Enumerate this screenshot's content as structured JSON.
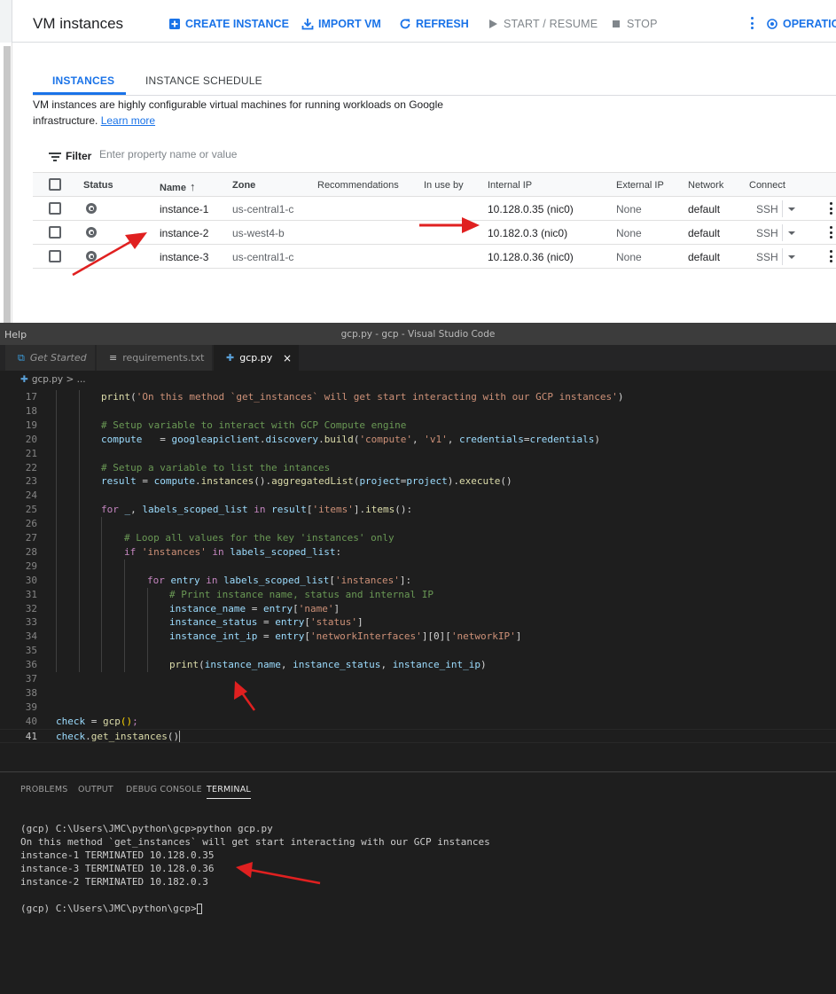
{
  "gcp": {
    "title": "VM instances",
    "toolbar": {
      "create": "CREATE INSTANCE",
      "import": "IMPORT VM",
      "refresh": "REFRESH",
      "start": "START / RESUME",
      "stop": "STOP",
      "operations": "OPERATION"
    },
    "tabs": [
      "INSTANCES",
      "INSTANCE SCHEDULE"
    ],
    "description": "VM instances are highly configurable virtual machines for running workloads on Google infrastructure.",
    "learn_more": "Learn more",
    "filter": {
      "label": "Filter",
      "placeholder": "Enter property name or value"
    },
    "columns": [
      "Status",
      "Name",
      "Zone",
      "Recommendations",
      "In use by",
      "Internal IP",
      "External IP",
      "Network",
      "Connect"
    ],
    "sort_indicator": "↑",
    "rows": [
      {
        "name": "instance-1",
        "zone": "us-central1-c",
        "ip": "10.128.0.35",
        "nic": "(nic0)",
        "external": "None",
        "network": "default",
        "connect": "SSH"
      },
      {
        "name": "instance-2",
        "zone": "us-west4-b",
        "ip": "10.182.0.3",
        "nic": "(nic0)",
        "external": "None",
        "network": "default",
        "connect": "SSH"
      },
      {
        "name": "instance-3",
        "zone": "us-central1-c",
        "ip": "10.128.0.36",
        "nic": "(nic0)",
        "external": "None",
        "network": "default",
        "connect": "SSH"
      }
    ]
  },
  "vscode": {
    "menu_help": "Help",
    "window_title": "gcp.py - gcp - Visual Studio Code",
    "tabs": [
      "Get Started",
      "requirements.txt",
      "gcp.py"
    ],
    "close_glyph": "×",
    "breadcrumb": "gcp.py > ...",
    "code": [
      {
        "n": "17",
        "i": 2,
        "t": [
          [
            "fn",
            "print"
          ],
          [
            "op",
            "("
          ],
          [
            "str",
            "'On this method `get_instances` will get start interacting with our GCP instances'"
          ],
          [
            "op",
            ")"
          ]
        ]
      },
      {
        "n": "18",
        "i": 2,
        "t": []
      },
      {
        "n": "19",
        "i": 2,
        "t": [
          [
            "cm",
            "# Setup variable to interact with GCP Compute engine"
          ]
        ]
      },
      {
        "n": "20",
        "i": 2,
        "t": [
          [
            "var",
            "compute"
          ],
          [
            "op",
            "   = "
          ],
          [
            "var",
            "googleapiclient"
          ],
          [
            "op",
            "."
          ],
          [
            "var",
            "discovery"
          ],
          [
            "op",
            "."
          ],
          [
            "fn",
            "build"
          ],
          [
            "op",
            "("
          ],
          [
            "str",
            "'compute'"
          ],
          [
            "op",
            ", "
          ],
          [
            "str",
            "'v1'"
          ],
          [
            "op",
            ", "
          ],
          [
            "var",
            "credentials"
          ],
          [
            "op",
            "="
          ],
          [
            "var",
            "credentials"
          ],
          [
            "op",
            ")"
          ]
        ]
      },
      {
        "n": "21",
        "i": 2,
        "t": []
      },
      {
        "n": "22",
        "i": 2,
        "t": [
          [
            "cm",
            "# Setup a variable to list the intances"
          ]
        ]
      },
      {
        "n": "23",
        "i": 2,
        "t": [
          [
            "var",
            "result"
          ],
          [
            "op",
            " = "
          ],
          [
            "var",
            "compute"
          ],
          [
            "op",
            "."
          ],
          [
            "fn",
            "instances"
          ],
          [
            "op",
            "()."
          ],
          [
            "fn",
            "aggregatedList"
          ],
          [
            "op",
            "("
          ],
          [
            "var",
            "project"
          ],
          [
            "op",
            "="
          ],
          [
            "var",
            "project"
          ],
          [
            "op",
            ")."
          ],
          [
            "fn",
            "execute"
          ],
          [
            "op",
            "()"
          ]
        ]
      },
      {
        "n": "24",
        "i": 2,
        "t": []
      },
      {
        "n": "25",
        "i": 2,
        "t": [
          [
            "kw",
            "for"
          ],
          [
            "op",
            " "
          ],
          [
            "var",
            "_"
          ],
          [
            "op",
            ", "
          ],
          [
            "var",
            "labels_scoped_list"
          ],
          [
            "op",
            " "
          ],
          [
            "kw",
            "in"
          ],
          [
            "op",
            " "
          ],
          [
            "var",
            "result"
          ],
          [
            "op",
            "["
          ],
          [
            "str",
            "'items'"
          ],
          [
            "op",
            "]."
          ],
          [
            "fn",
            "items"
          ],
          [
            "op",
            "():"
          ]
        ]
      },
      {
        "n": "26",
        "i": 3,
        "t": []
      },
      {
        "n": "27",
        "i": 3,
        "t": [
          [
            "cm",
            "# Loop all values for the key 'instances' only"
          ]
        ]
      },
      {
        "n": "28",
        "i": 3,
        "t": [
          [
            "kw",
            "if"
          ],
          [
            "op",
            " "
          ],
          [
            "str",
            "'instances'"
          ],
          [
            "op",
            " "
          ],
          [
            "kw",
            "in"
          ],
          [
            "op",
            " "
          ],
          [
            "var",
            "labels_scoped_list"
          ],
          [
            "op",
            ":"
          ]
        ]
      },
      {
        "n": "29",
        "i": 4,
        "t": []
      },
      {
        "n": "30",
        "i": 4,
        "t": [
          [
            "kw",
            "for"
          ],
          [
            "op",
            " "
          ],
          [
            "var",
            "entry"
          ],
          [
            "op",
            " "
          ],
          [
            "kw",
            "in"
          ],
          [
            "op",
            " "
          ],
          [
            "var",
            "labels_scoped_list"
          ],
          [
            "op",
            "["
          ],
          [
            "str",
            "'instances'"
          ],
          [
            "op",
            "]:"
          ]
        ]
      },
      {
        "n": "31",
        "i": 5,
        "t": [
          [
            "cm",
            "# Print instance name, status and internal IP"
          ]
        ]
      },
      {
        "n": "32",
        "i": 5,
        "t": [
          [
            "var",
            "instance_name"
          ],
          [
            "op",
            " = "
          ],
          [
            "var",
            "entry"
          ],
          [
            "op",
            "["
          ],
          [
            "str",
            "'name'"
          ],
          [
            "op",
            "]"
          ]
        ]
      },
      {
        "n": "33",
        "i": 5,
        "t": [
          [
            "var",
            "instance_status"
          ],
          [
            "op",
            " = "
          ],
          [
            "var",
            "entry"
          ],
          [
            "op",
            "["
          ],
          [
            "str",
            "'status'"
          ],
          [
            "op",
            "]"
          ]
        ]
      },
      {
        "n": "34",
        "i": 5,
        "t": [
          [
            "var",
            "instance_int_ip"
          ],
          [
            "op",
            " = "
          ],
          [
            "var",
            "entry"
          ],
          [
            "op",
            "["
          ],
          [
            "str",
            "'networkInterfaces'"
          ],
          [
            "op",
            "][0]["
          ],
          [
            "str",
            "'networkIP'"
          ],
          [
            "op",
            "]"
          ]
        ]
      },
      {
        "n": "35",
        "i": 5,
        "t": []
      },
      {
        "n": "36",
        "i": 5,
        "t": [
          [
            "fn",
            "print"
          ],
          [
            "op",
            "("
          ],
          [
            "var",
            "instance_name"
          ],
          [
            "op",
            ", "
          ],
          [
            "var",
            "instance_status"
          ],
          [
            "op",
            ", "
          ],
          [
            "var",
            "instance_int_ip"
          ],
          [
            "op",
            ")"
          ]
        ]
      },
      {
        "n": "37",
        "i": 0,
        "t": []
      },
      {
        "n": "38",
        "i": 0,
        "t": []
      },
      {
        "n": "39",
        "i": 0,
        "t": []
      },
      {
        "n": "40",
        "i": 0,
        "t": [
          [
            "var",
            "check"
          ],
          [
            "op",
            " = "
          ],
          [
            "fn",
            "gcp"
          ],
          [
            "punc",
            "()"
          ],
          [
            "kw",
            ";"
          ]
        ]
      },
      {
        "n": "41",
        "i": 0,
        "t": [
          [
            "var",
            "check"
          ],
          [
            "op",
            "."
          ],
          [
            "fn",
            "get_instances"
          ],
          [
            "op",
            "()"
          ]
        ]
      }
    ],
    "panel_tabs": [
      "PROBLEMS",
      "OUTPUT",
      "DEBUG CONSOLE",
      "TERMINAL"
    ],
    "terminal": [
      "(gcp) C:\\Users\\JMC\\python\\gcp>python gcp.py",
      "On this method `get_instances` will get start interacting with our GCP instances",
      "instance-1 TERMINATED 10.128.0.35",
      "instance-3 TERMINATED 10.128.0.36",
      "instance-2 TERMINATED 10.182.0.3",
      "",
      "(gcp) C:\\Users\\JMC\\python\\gcp>"
    ]
  },
  "colors": {
    "accent": "#1a73e8",
    "annotation": "#e02020",
    "editor_bg": "#1e1e1e"
  }
}
